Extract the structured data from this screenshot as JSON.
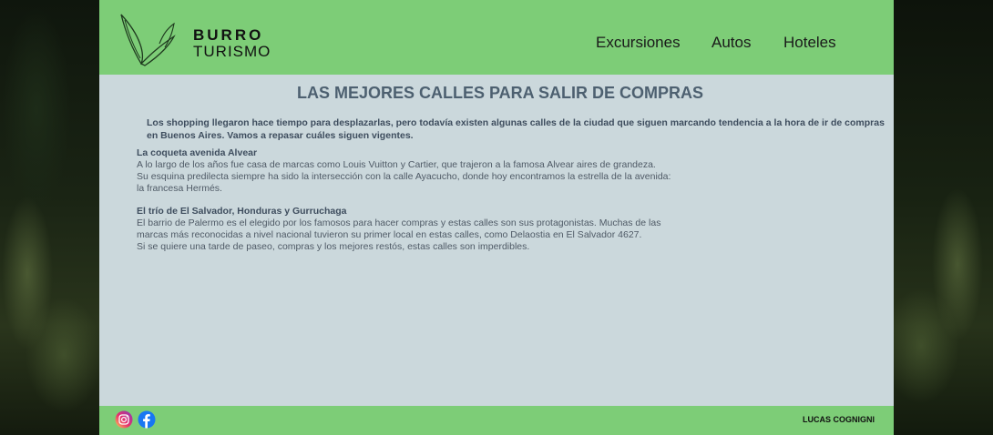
{
  "brand": {
    "line1": "BURRO",
    "line2": "TURISMO"
  },
  "nav": {
    "items": [
      "Excursiones",
      "Autos",
      "Hoteles"
    ]
  },
  "main": {
    "title": "LAS MEJORES CALLES PARA SALIR DE COMPRAS",
    "intro": "Los shopping llegaron hace tiempo para desplazarlas, pero todavía existen algunas calles de la ciudad que siguen marcando tendencia a la hora de ir de compras en Buenos Aires. Vamos a repasar cuáles siguen vigentes.",
    "sections": [
      {
        "title": "La coqueta avenida Alvear",
        "lines": [
          "A lo largo de los años fue casa de marcas como Louis Vuitton y Cartier, que trajeron a la famosa Alvear aires de grandeza.",
          "Su esquina predilecta siempre ha sido la intersección con la calle Ayacucho, donde hoy encontramos la estrella de la avenida:",
          "la francesa Hermés."
        ]
      },
      {
        "title": "El trío de El Salvador, Honduras y Gurruchaga",
        "lines": [
          "El barrio de Palermo es el elegido por los famosos para hacer compras y estas calles son sus protagonistas. Muchas de las",
          "marcas más reconocidas a nivel nacional tuvieron su primer local en estas calles, como Delaostia en El Salvador 4627.",
          "Si se quiere una tarde de paseo, compras y los mejores restós, estas calles son imperdibles."
        ]
      }
    ]
  },
  "footer": {
    "author": "LUCAS COGNIGNI",
    "social": [
      "instagram-icon",
      "facebook-icon"
    ]
  },
  "colors": {
    "header_bg": "#7dcd77",
    "content_bg": "#cbd8dc",
    "title": "#4d6070",
    "facebook": "#1877f2"
  }
}
